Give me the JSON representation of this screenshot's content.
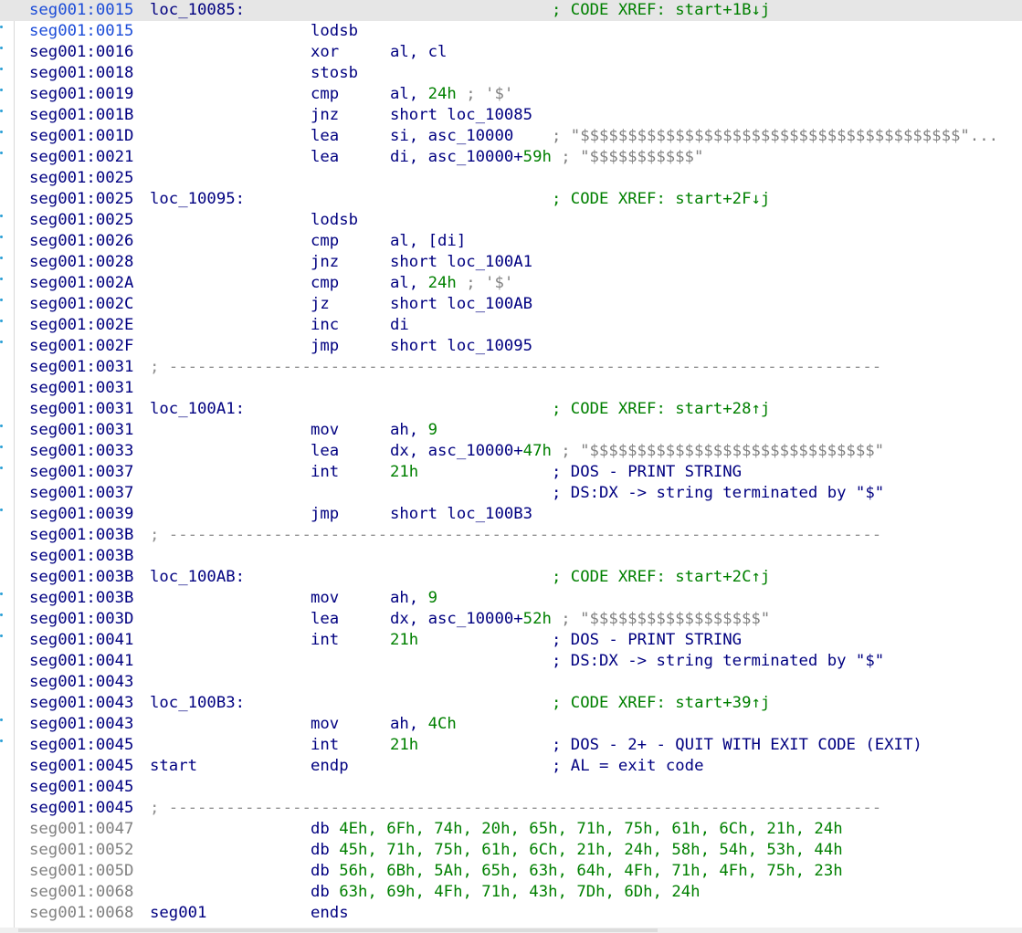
{
  "lines": [
    {
      "addr": "seg001:0015",
      "label": "loc_10085:",
      "cmt": [
        [
          "; CODE XREF: start+1B↓j",
          "green"
        ]
      ],
      "hl": true,
      "sel": true
    },
    {
      "addr": "seg001:0015",
      "mnem": "lodsb",
      "sel": true,
      "dot": true
    },
    {
      "addr": "seg001:0016",
      "mnem": "xor",
      "op": [
        [
          "al, cl",
          ""
        ]
      ],
      "dot": true
    },
    {
      "addr": "seg001:0018",
      "mnem": "stosb",
      "dot": true
    },
    {
      "addr": "seg001:0019",
      "mnem": "cmp",
      "op": [
        [
          "al, ",
          ""
        ],
        [
          "24h",
          "green"
        ],
        [
          " ; '$'",
          "strc"
        ]
      ],
      "dot": true
    },
    {
      "addr": "seg001:001B",
      "mnem": "jnz",
      "op": [
        [
          "short loc_10085",
          ""
        ]
      ],
      "dot": true
    },
    {
      "addr": "seg001:001D",
      "mnem": "lea",
      "op": [
        [
          "si, asc_10000",
          ""
        ]
      ],
      "cmt": [
        [
          "; \"$$$$$$$$$$$$$$$$$$$$$$$$$$$$$$$$$$$$$$$$\"...",
          "strc"
        ]
      ],
      "dot": true
    },
    {
      "addr": "seg001:0021",
      "mnem": "lea",
      "op": [
        [
          "di, asc_10000+",
          ""
        ],
        [
          "59h",
          "green"
        ],
        [
          " ; \"$$$$$$$$$$$\"",
          "strc"
        ]
      ],
      "dot": true
    },
    {
      "addr": "seg001:0025"
    },
    {
      "addr": "seg001:0025",
      "label": "loc_10095:",
      "cmt": [
        [
          "; CODE XREF: start+2F↓j",
          "green"
        ]
      ]
    },
    {
      "addr": "seg001:0025",
      "mnem": "lodsb",
      "dot": true
    },
    {
      "addr": "seg001:0026",
      "mnem": "cmp",
      "op": [
        [
          "al, [di]",
          ""
        ]
      ],
      "dot": true
    },
    {
      "addr": "seg001:0028",
      "mnem": "jnz",
      "op": [
        [
          "short loc_100A1",
          ""
        ]
      ],
      "dot": true
    },
    {
      "addr": "seg001:002A",
      "mnem": "cmp",
      "op": [
        [
          "al, ",
          ""
        ],
        [
          "24h",
          "green"
        ],
        [
          " ; '$'",
          "strc"
        ]
      ],
      "dot": true
    },
    {
      "addr": "seg001:002C",
      "mnem": "jz",
      "op": [
        [
          "short loc_100AB",
          ""
        ]
      ],
      "dot": true
    },
    {
      "addr": "seg001:002E",
      "mnem": "inc",
      "op": [
        [
          "di",
          ""
        ]
      ],
      "dot": true
    },
    {
      "addr": "seg001:002F",
      "mnem": "jmp",
      "op": [
        [
          "short loc_10095",
          ""
        ]
      ],
      "dot": true
    },
    {
      "addr": "seg001:0031",
      "sep": "; ---------------------------------------------------------------------------"
    },
    {
      "addr": "seg001:0031"
    },
    {
      "addr": "seg001:0031",
      "label": "loc_100A1:",
      "cmt": [
        [
          "; CODE XREF: start+28↑j",
          "green"
        ]
      ]
    },
    {
      "addr": "seg001:0031",
      "mnem": "mov",
      "op": [
        [
          "ah, ",
          ""
        ],
        [
          "9",
          "green"
        ]
      ],
      "dot": true
    },
    {
      "addr": "seg001:0033",
      "mnem": "lea",
      "op": [
        [
          "dx, asc_10000+",
          ""
        ],
        [
          "47h",
          "green"
        ],
        [
          " ; \"$$$$$$$$$$$$$$$$$$$$$$$$$$$$$$\"",
          "strc"
        ]
      ],
      "dot": true
    },
    {
      "addr": "seg001:0037",
      "mnem": "int",
      "op": [
        [
          "21h",
          "green"
        ]
      ],
      "cmt": [
        [
          "; DOS - PRINT STRING",
          ""
        ]
      ],
      "dot": true
    },
    {
      "addr": "seg001:0037",
      "cmt": [
        [
          "; DS:DX -> string terminated by \"$\"",
          ""
        ]
      ]
    },
    {
      "addr": "seg001:0039",
      "mnem": "jmp",
      "op": [
        [
          "short loc_100B3",
          ""
        ]
      ],
      "dot": true
    },
    {
      "addr": "seg001:003B",
      "sep": "; ---------------------------------------------------------------------------"
    },
    {
      "addr": "seg001:003B"
    },
    {
      "addr": "seg001:003B",
      "label": "loc_100AB:",
      "cmt": [
        [
          "; CODE XREF: start+2C↑j",
          "green"
        ]
      ]
    },
    {
      "addr": "seg001:003B",
      "mnem": "mov",
      "op": [
        [
          "ah, ",
          ""
        ],
        [
          "9",
          "green"
        ]
      ],
      "dot": true
    },
    {
      "addr": "seg001:003D",
      "mnem": "lea",
      "op": [
        [
          "dx, asc_10000+",
          ""
        ],
        [
          "52h",
          "green"
        ],
        [
          " ; \"$$$$$$$$$$$$$$$$$$\"",
          "strc"
        ]
      ],
      "dot": true
    },
    {
      "addr": "seg001:0041",
      "mnem": "int",
      "op": [
        [
          "21h",
          "green"
        ]
      ],
      "cmt": [
        [
          "; DOS - PRINT STRING",
          ""
        ]
      ],
      "dot": true
    },
    {
      "addr": "seg001:0041",
      "cmt": [
        [
          "; DS:DX -> string terminated by \"$\"",
          ""
        ]
      ]
    },
    {
      "addr": "seg001:0043"
    },
    {
      "addr": "seg001:0043",
      "label": "loc_100B3:",
      "cmt": [
        [
          "; CODE XREF: start+39↑j",
          "green"
        ]
      ]
    },
    {
      "addr": "seg001:0043",
      "mnem": "mov",
      "op": [
        [
          "ah, ",
          ""
        ],
        [
          "4Ch",
          "green"
        ]
      ],
      "dot": true
    },
    {
      "addr": "seg001:0045",
      "mnem": "int",
      "op": [
        [
          "21h",
          "green"
        ]
      ],
      "cmt": [
        [
          "; DOS - 2+ - QUIT WITH EXIT CODE (EXIT)",
          ""
        ]
      ],
      "dot": true
    },
    {
      "addr": "seg001:0045",
      "label": "start",
      "mnem": "endp",
      "cmt": [
        [
          "; AL = exit code",
          ""
        ]
      ]
    },
    {
      "addr": "seg001:0045"
    },
    {
      "addr": "seg001:0045",
      "sep": "; ---------------------------------------------------------------------------"
    },
    {
      "addr": "seg001:0047",
      "gray": true,
      "db": [
        [
          "db ",
          ""
        ],
        [
          "4Eh, 6Fh, 74h, 20h, 65h, 71h, 75h, 61h, 6Ch, 21h, 24h",
          "green"
        ]
      ]
    },
    {
      "addr": "seg001:0052",
      "gray": true,
      "db": [
        [
          "db ",
          ""
        ],
        [
          "45h, 71h, 75h, 61h, 6Ch, 21h, 24h, 58h, 54h, 53h, 44h",
          "green"
        ]
      ]
    },
    {
      "addr": "seg001:005D",
      "gray": true,
      "db": [
        [
          "db ",
          ""
        ],
        [
          "56h, 6Bh, 5Ah, 65h, 63h, 64h, 4Fh, 71h, 4Fh, 75h, 23h",
          "green"
        ]
      ]
    },
    {
      "addr": "seg001:0068",
      "gray": true,
      "db": [
        [
          "db ",
          ""
        ],
        [
          "63h, 69h, 4Fh, 71h, 43h, 7Dh, 6Dh, 24h",
          "green"
        ]
      ]
    },
    {
      "addr": "seg001:0068",
      "gray": true,
      "label": "seg001",
      "mnem": "ends"
    }
  ]
}
